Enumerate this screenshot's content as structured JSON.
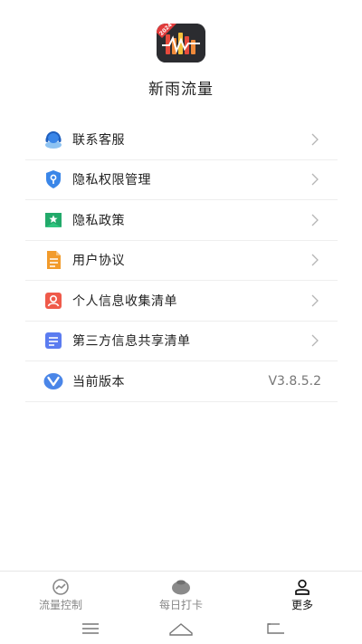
{
  "app": {
    "name": "新雨流量",
    "badge_text": "2024"
  },
  "menu": {
    "items": [
      {
        "label": "联系客服",
        "icon": "headset-icon",
        "color": "#3a86e8"
      },
      {
        "label": "隐私权限管理",
        "icon": "shield-key-icon",
        "color": "#3a86e8"
      },
      {
        "label": "隐私政策",
        "icon": "bookmark-star-icon",
        "color": "#2fc47f"
      },
      {
        "label": "用户协议",
        "icon": "document-icon",
        "color": "#f29b2b"
      },
      {
        "label": "个人信息收集清单",
        "icon": "person-card-icon",
        "color": "#ef5a4a"
      },
      {
        "label": "第三方信息共享清单",
        "icon": "list-doc-icon",
        "color": "#5b7cf0"
      },
      {
        "label": "当前版本",
        "icon": "version-v-icon",
        "color": "#4a86e8",
        "value": "V3.8.5.2"
      }
    ]
  },
  "tabs": [
    {
      "label": "流量控制",
      "icon": "gauge-icon",
      "active": false
    },
    {
      "label": "每日打卡",
      "icon": "coin-pouch-icon",
      "active": false
    },
    {
      "label": "更多",
      "icon": "person-icon",
      "active": true
    }
  ],
  "system_nav": [
    "menu-icon",
    "home-icon",
    "back-icon"
  ]
}
